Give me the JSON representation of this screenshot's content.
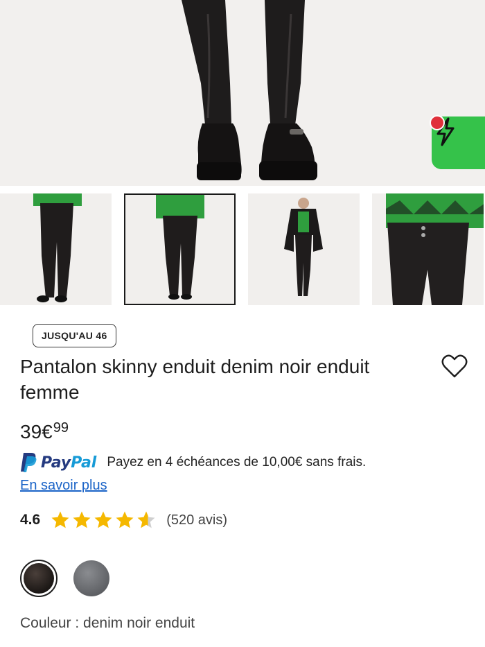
{
  "product": {
    "size_badge": "JUSQU'AU 46",
    "title": "Pantalon skinny enduit denim noir enduit femme",
    "price_main": "39€",
    "price_cents": "99",
    "paypal": {
      "brand_part1": "Pay",
      "brand_part2": "Pal",
      "text": "Payez en 4 échéances de 10,00€ sans frais.",
      "link": "En savoir plus"
    },
    "rating": {
      "value": "4.6",
      "stars": 4.6,
      "reviews": "(520 avis)"
    },
    "color_label": "Couleur : denim noir enduit",
    "swatches": [
      "denim noir enduit",
      "gris"
    ]
  },
  "thumbnails": [
    "front-view",
    "back-view",
    "full-outfit",
    "waist-closeup"
  ],
  "selected_thumbnail": 1,
  "colors": {
    "flash_green": "#35c24a",
    "notification_red": "#e0303a",
    "link_blue": "#1a63c7",
    "star_gold": "#f5b800",
    "paypal_dark": "#253b80",
    "paypal_light": "#179bd7"
  },
  "icons": {
    "flash": "lightning-icon",
    "favorite": "heart-icon",
    "paypal": "paypal-logo-icon",
    "star": "star-icon"
  }
}
